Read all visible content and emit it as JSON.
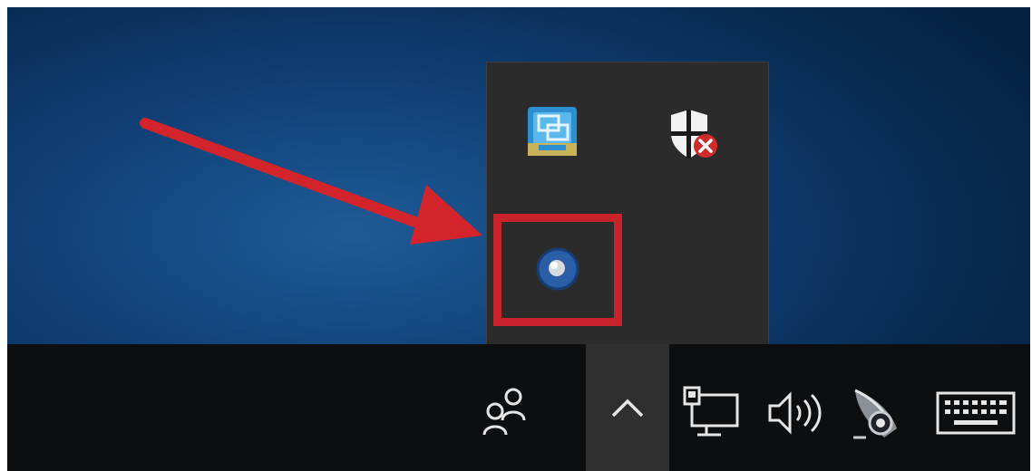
{
  "colors": {
    "desktop_blue": "#0f3f75",
    "taskbar": "#0d0e10",
    "overflow_panel": "#2b2b2b",
    "chevron_bg": "#2f2f2f",
    "annotation_red": "#d4242b",
    "icon_white": "#e6e6e6"
  },
  "overflow_tray": {
    "icons": [
      {
        "name": "intel-graphics-tray-icon"
      },
      {
        "name": "security-center-warning-icon"
      },
      {
        "name": "blue-round-app-tray-icon",
        "highlighted": true
      }
    ]
  },
  "annotation": {
    "arrow": "red-arrow-pointing-to-highlighted-icon",
    "highlight": "red-square-highlight"
  },
  "taskbar": {
    "icons": [
      {
        "name": "people-icon"
      },
      {
        "name": "show-hidden-icons-chevron-icon"
      },
      {
        "name": "network-icon"
      },
      {
        "name": "volume-icon"
      },
      {
        "name": "windows-ink-workspace-icon"
      },
      {
        "name": "touch-keyboard-icon"
      }
    ]
  }
}
